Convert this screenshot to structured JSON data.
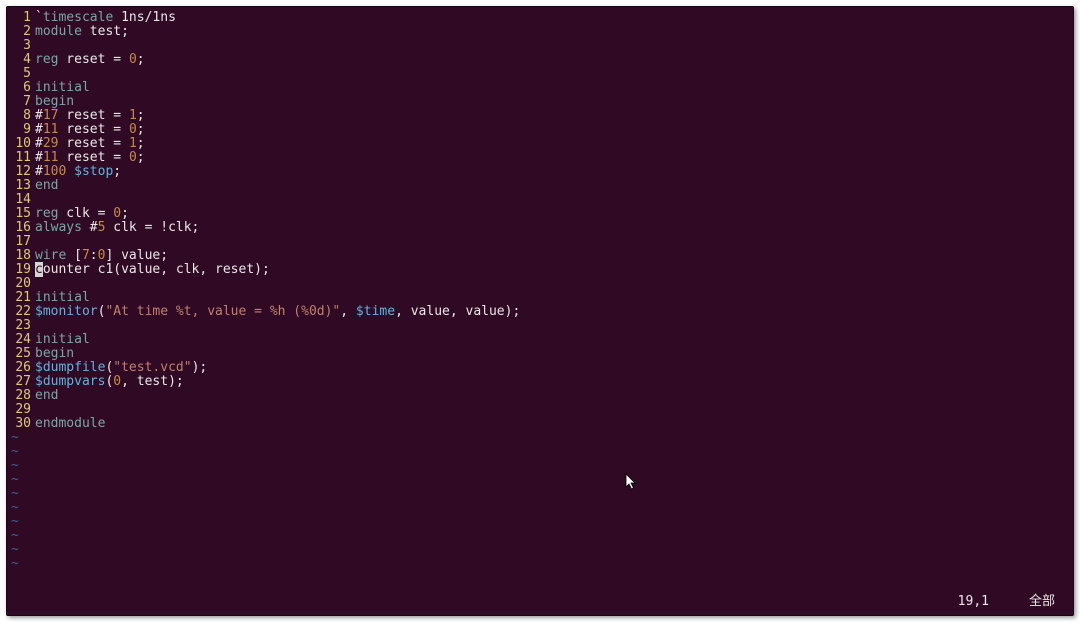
{
  "status": {
    "position": "19,1",
    "label": "全部"
  },
  "tilde": "~",
  "cursor_char": "c",
  "lines": [
    {
      "n": "1",
      "tokens": [
        [
          "plain",
          "`"
        ],
        [
          "kw",
          "timescale"
        ],
        [
          "plain",
          " 1ns/1ns"
        ]
      ]
    },
    {
      "n": "2",
      "tokens": [
        [
          "kw",
          "module"
        ],
        [
          "plain",
          " test;"
        ]
      ]
    },
    {
      "n": "3",
      "tokens": []
    },
    {
      "n": "4",
      "tokens": [
        [
          "kw",
          "reg"
        ],
        [
          "plain",
          " reset = "
        ],
        [
          "num",
          "0"
        ],
        [
          "plain",
          ";"
        ]
      ]
    },
    {
      "n": "5",
      "tokens": []
    },
    {
      "n": "6",
      "tokens": [
        [
          "kw",
          "initial"
        ]
      ]
    },
    {
      "n": "7",
      "tokens": [
        [
          "kw",
          "begin"
        ]
      ]
    },
    {
      "n": "8",
      "tokens": [
        [
          "plain",
          "#"
        ],
        [
          "num",
          "17"
        ],
        [
          "plain",
          " reset = "
        ],
        [
          "num",
          "1"
        ],
        [
          "plain",
          ";"
        ]
      ]
    },
    {
      "n": "9",
      "tokens": [
        [
          "plain",
          "#"
        ],
        [
          "num",
          "11"
        ],
        [
          "plain",
          " reset = "
        ],
        [
          "num",
          "0"
        ],
        [
          "plain",
          ";"
        ]
      ]
    },
    {
      "n": "10",
      "tokens": [
        [
          "plain",
          "#"
        ],
        [
          "num",
          "29"
        ],
        [
          "plain",
          " reset = "
        ],
        [
          "num",
          "1"
        ],
        [
          "plain",
          ";"
        ]
      ]
    },
    {
      "n": "11",
      "tokens": [
        [
          "plain",
          "#"
        ],
        [
          "num",
          "11"
        ],
        [
          "plain",
          " reset = "
        ],
        [
          "num",
          "0"
        ],
        [
          "plain",
          ";"
        ]
      ]
    },
    {
      "n": "12",
      "tokens": [
        [
          "plain",
          "#"
        ],
        [
          "num",
          "100"
        ],
        [
          "plain",
          " "
        ],
        [
          "sys",
          "$stop"
        ],
        [
          "plain",
          ";"
        ]
      ]
    },
    {
      "n": "13",
      "tokens": [
        [
          "kw",
          "end"
        ]
      ]
    },
    {
      "n": "14",
      "tokens": []
    },
    {
      "n": "15",
      "tokens": [
        [
          "kw",
          "reg"
        ],
        [
          "plain",
          " clk = "
        ],
        [
          "num",
          "0"
        ],
        [
          "plain",
          ";"
        ]
      ]
    },
    {
      "n": "16",
      "tokens": [
        [
          "kw",
          "always"
        ],
        [
          "plain",
          " #"
        ],
        [
          "num",
          "5"
        ],
        [
          "plain",
          " clk = !clk;"
        ]
      ]
    },
    {
      "n": "17",
      "tokens": []
    },
    {
      "n": "18",
      "tokens": [
        [
          "kw",
          "wire"
        ],
        [
          "plain",
          " ["
        ],
        [
          "num",
          "7"
        ],
        [
          "plain",
          ":"
        ],
        [
          "num",
          "0"
        ],
        [
          "plain",
          "] value;"
        ]
      ]
    },
    {
      "n": "19",
      "cursor": true,
      "tokens": [
        [
          "plain",
          "ounter c1(value, clk, reset);"
        ]
      ]
    },
    {
      "n": "20",
      "tokens": []
    },
    {
      "n": "21",
      "tokens": [
        [
          "kw",
          "initial"
        ]
      ]
    },
    {
      "n": "22",
      "tokens": [
        [
          "sys",
          "$monitor"
        ],
        [
          "plain",
          "("
        ],
        [
          "str",
          "\"At time %t, value = %h (%0d)\""
        ],
        [
          "plain",
          ", "
        ],
        [
          "sys",
          "$time"
        ],
        [
          "plain",
          ", value, value);"
        ]
      ]
    },
    {
      "n": "23",
      "tokens": []
    },
    {
      "n": "24",
      "tokens": [
        [
          "kw",
          "initial"
        ]
      ]
    },
    {
      "n": "25",
      "tokens": [
        [
          "kw",
          "begin"
        ]
      ]
    },
    {
      "n": "26",
      "tokens": [
        [
          "sys",
          "$dumpfile"
        ],
        [
          "plain",
          "("
        ],
        [
          "str",
          "\"test.vcd\""
        ],
        [
          "plain",
          ");"
        ]
      ]
    },
    {
      "n": "27",
      "tokens": [
        [
          "sys",
          "$dumpvars"
        ],
        [
          "plain",
          "("
        ],
        [
          "num",
          "0"
        ],
        [
          "plain",
          ", test);"
        ]
      ]
    },
    {
      "n": "28",
      "tokens": [
        [
          "kw",
          "end"
        ]
      ]
    },
    {
      "n": "29",
      "tokens": []
    },
    {
      "n": "30",
      "tokens": [
        [
          "kw",
          "endmodule"
        ]
      ]
    }
  ],
  "tilde_rows": 10
}
